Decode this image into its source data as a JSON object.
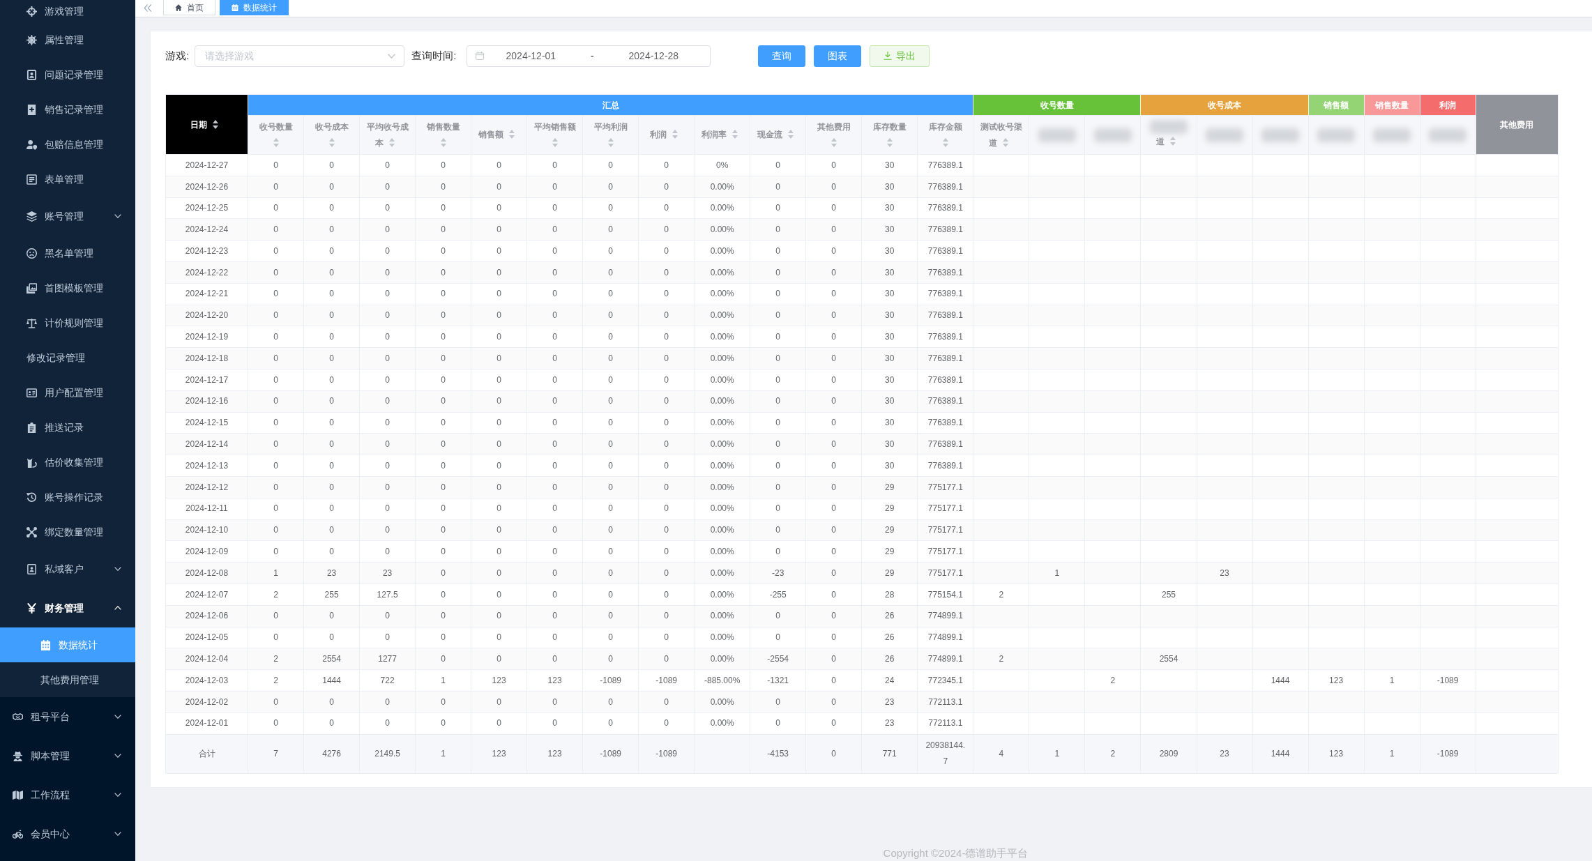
{
  "sidebar": {
    "submenu_items": [
      {
        "label": "游戏管理",
        "kind": "link",
        "selected": false
      },
      {
        "label": "属性管理",
        "kind": "link",
        "selected": false
      },
      {
        "label": "问题记录管理",
        "kind": "link",
        "selected": false
      },
      {
        "label": "销售记录管理",
        "kind": "link",
        "selected": false
      },
      {
        "label": "包赔信息管理",
        "kind": "link",
        "selected": false
      },
      {
        "label": "表单管理",
        "kind": "link",
        "selected": false
      },
      {
        "label": "账号管理",
        "kind": "submenu",
        "selected": false,
        "expanded": false
      },
      {
        "label": "黑名单管理",
        "kind": "link",
        "selected": false
      },
      {
        "label": "首图模板管理",
        "kind": "link",
        "selected": false
      },
      {
        "label": "计价规则管理",
        "kind": "link",
        "selected": false
      },
      {
        "label": "修改记录管理",
        "kind": "link",
        "selected": false
      },
      {
        "label": "用户配置管理",
        "kind": "link",
        "selected": false
      },
      {
        "label": "推送记录",
        "kind": "link",
        "selected": false
      },
      {
        "label": "估价收集管理",
        "kind": "link",
        "selected": false
      },
      {
        "label": "账号操作记录",
        "kind": "link",
        "selected": false
      },
      {
        "label": "绑定数量管理",
        "kind": "link",
        "selected": false
      },
      {
        "label": "私域客户",
        "kind": "submenu",
        "selected": false,
        "expanded": false
      },
      {
        "label": "财务管理",
        "kind": "submenu",
        "selected": false,
        "expanded": true,
        "children": [
          {
            "label": "数据统计",
            "selected": true
          },
          {
            "label": "其他费用管理",
            "selected": false
          }
        ]
      }
    ],
    "items": [
      {
        "label": "租号平台",
        "kind": "submenu",
        "selected": false,
        "expanded": false
      },
      {
        "label": "脚本管理",
        "kind": "submenu",
        "selected": false,
        "expanded": false
      },
      {
        "label": "工作流程",
        "kind": "submenu",
        "selected": false,
        "expanded": false
      },
      {
        "label": "会员中心",
        "kind": "submenu",
        "selected": false,
        "expanded": false
      }
    ]
  },
  "tabs": [
    {
      "label": "首页",
      "selected": false
    },
    {
      "label": "数据统计",
      "selected": true
    }
  ],
  "filters": {
    "game": {
      "label": "游戏:",
      "placeholder": "请选择游戏"
    },
    "date_range": {
      "label": "查询时间:",
      "start": "2024-12-01",
      "separator": "-",
      "end": "2024-12-28"
    },
    "buttons": [
      {
        "label": "查询",
        "kind": "primary"
      },
      {
        "label": "图表",
        "kind": "primary"
      },
      {
        "label": "导出",
        "kind": "export"
      }
    ]
  },
  "table": {
    "header": [
      {
        "kind": "single",
        "label": "日期",
        "color": "#000000",
        "sortable": true
      },
      {
        "kind": "group",
        "label": "汇总",
        "color": "#409eff",
        "columns": [
          {
            "label": "收号数量",
            "blurred": false
          },
          {
            "label": "收号成本",
            "blurred": false
          },
          {
            "label": "平均收号成本",
            "blurred": false
          },
          {
            "label": "销售数量",
            "blurred": false
          },
          {
            "label": "销售额",
            "blurred": false
          },
          {
            "label": "平均销售额",
            "blurred": false
          },
          {
            "label": "平均利润",
            "blurred": false
          },
          {
            "label": "利润",
            "blurred": false
          },
          {
            "label": "利润率",
            "blurred": false
          },
          {
            "label": "现金流",
            "blurred": false
          },
          {
            "label": "其他费用",
            "blurred": false
          },
          {
            "label": "库存数量",
            "blurred": false
          },
          {
            "label": "库存金额",
            "blurred": false
          }
        ]
      },
      {
        "kind": "group",
        "label": "收号数量",
        "color": "#67c23a",
        "columns": [
          {
            "label": "测试收号渠道",
            "blurred": false
          },
          {
            "blurred": true
          },
          {
            "blurred": true
          }
        ]
      },
      {
        "kind": "group",
        "label": "收号成本",
        "color": "#e6a23c",
        "columns": [
          {
            "label": "道",
            "blurred": true
          },
          {
            "blurred": true
          },
          {
            "blurred": true
          }
        ]
      },
      {
        "kind": "group",
        "label": "销售额",
        "color": "#95d475",
        "columns": [
          {
            "blurred": true
          }
        ]
      },
      {
        "kind": "group",
        "label": "销售数量",
        "color": "#f89898",
        "columns": [
          {
            "blurred": true
          }
        ]
      },
      {
        "kind": "group",
        "label": "利润",
        "color": "#f56c6c",
        "columns": [
          {
            "blurred": true
          }
        ]
      },
      {
        "kind": "single",
        "label": "其他费用",
        "color": "#909399",
        "sortable": false
      }
    ],
    "rows": [
      {
        "date": "2024-12-27",
        "cells": [
          "0",
          "0",
          "0",
          "0",
          "0",
          "0",
          "0",
          "0",
          "0%",
          "0",
          "0",
          "30",
          "776389.1",
          null,
          null,
          null,
          null,
          null,
          null,
          null,
          null,
          null,
          null
        ]
      },
      {
        "date": "2024-12-26",
        "cells": [
          "0",
          "0",
          "0",
          "0",
          "0",
          "0",
          "0",
          "0",
          "0.00%",
          "0",
          "0",
          "30",
          "776389.1",
          null,
          null,
          null,
          null,
          null,
          null,
          null,
          null,
          null,
          null
        ]
      },
      {
        "date": "2024-12-25",
        "cells": [
          "0",
          "0",
          "0",
          "0",
          "0",
          "0",
          "0",
          "0",
          "0.00%",
          "0",
          "0",
          "30",
          "776389.1",
          null,
          null,
          null,
          null,
          null,
          null,
          null,
          null,
          null,
          null
        ]
      },
      {
        "date": "2024-12-24",
        "cells": [
          "0",
          "0",
          "0",
          "0",
          "0",
          "0",
          "0",
          "0",
          "0.00%",
          "0",
          "0",
          "30",
          "776389.1",
          null,
          null,
          null,
          null,
          null,
          null,
          null,
          null,
          null,
          null
        ]
      },
      {
        "date": "2024-12-23",
        "cells": [
          "0",
          "0",
          "0",
          "0",
          "0",
          "0",
          "0",
          "0",
          "0.00%",
          "0",
          "0",
          "30",
          "776389.1",
          null,
          null,
          null,
          null,
          null,
          null,
          null,
          null,
          null,
          null
        ]
      },
      {
        "date": "2024-12-22",
        "cells": [
          "0",
          "0",
          "0",
          "0",
          "0",
          "0",
          "0",
          "0",
          "0.00%",
          "0",
          "0",
          "30",
          "776389.1",
          null,
          null,
          null,
          null,
          null,
          null,
          null,
          null,
          null,
          null
        ]
      },
      {
        "date": "2024-12-21",
        "cells": [
          "0",
          "0",
          "0",
          "0",
          "0",
          "0",
          "0",
          "0",
          "0.00%",
          "0",
          "0",
          "30",
          "776389.1",
          null,
          null,
          null,
          null,
          null,
          null,
          null,
          null,
          null,
          null
        ]
      },
      {
        "date": "2024-12-20",
        "cells": [
          "0",
          "0",
          "0",
          "0",
          "0",
          "0",
          "0",
          "0",
          "0.00%",
          "0",
          "0",
          "30",
          "776389.1",
          null,
          null,
          null,
          null,
          null,
          null,
          null,
          null,
          null,
          null
        ]
      },
      {
        "date": "2024-12-19",
        "cells": [
          "0",
          "0",
          "0",
          "0",
          "0",
          "0",
          "0",
          "0",
          "0.00%",
          "0",
          "0",
          "30",
          "776389.1",
          null,
          null,
          null,
          null,
          null,
          null,
          null,
          null,
          null,
          null
        ]
      },
      {
        "date": "2024-12-18",
        "cells": [
          "0",
          "0",
          "0",
          "0",
          "0",
          "0",
          "0",
          "0",
          "0.00%",
          "0",
          "0",
          "30",
          "776389.1",
          null,
          null,
          null,
          null,
          null,
          null,
          null,
          null,
          null,
          null
        ]
      },
      {
        "date": "2024-12-17",
        "cells": [
          "0",
          "0",
          "0",
          "0",
          "0",
          "0",
          "0",
          "0",
          "0.00%",
          "0",
          "0",
          "30",
          "776389.1",
          null,
          null,
          null,
          null,
          null,
          null,
          null,
          null,
          null,
          null
        ]
      },
      {
        "date": "2024-12-16",
        "cells": [
          "0",
          "0",
          "0",
          "0",
          "0",
          "0",
          "0",
          "0",
          "0.00%",
          "0",
          "0",
          "30",
          "776389.1",
          null,
          null,
          null,
          null,
          null,
          null,
          null,
          null,
          null,
          null
        ]
      },
      {
        "date": "2024-12-15",
        "cells": [
          "0",
          "0",
          "0",
          "0",
          "0",
          "0",
          "0",
          "0",
          "0.00%",
          "0",
          "0",
          "30",
          "776389.1",
          null,
          null,
          null,
          null,
          null,
          null,
          null,
          null,
          null,
          null
        ]
      },
      {
        "date": "2024-12-14",
        "cells": [
          "0",
          "0",
          "0",
          "0",
          "0",
          "0",
          "0",
          "0",
          "0.00%",
          "0",
          "0",
          "30",
          "776389.1",
          null,
          null,
          null,
          null,
          null,
          null,
          null,
          null,
          null,
          null
        ]
      },
      {
        "date": "2024-12-13",
        "cells": [
          "0",
          "0",
          "0",
          "0",
          "0",
          "0",
          "0",
          "0",
          "0.00%",
          "0",
          "0",
          "30",
          "776389.1",
          null,
          null,
          null,
          null,
          null,
          null,
          null,
          null,
          null,
          null
        ]
      },
      {
        "date": "2024-12-12",
        "cells": [
          "0",
          "0",
          "0",
          "0",
          "0",
          "0",
          "0",
          "0",
          "0.00%",
          "0",
          "0",
          "29",
          "775177.1",
          null,
          null,
          null,
          null,
          null,
          null,
          null,
          null,
          null,
          null
        ]
      },
      {
        "date": "2024-12-11",
        "cells": [
          "0",
          "0",
          "0",
          "0",
          "0",
          "0",
          "0",
          "0",
          "0.00%",
          "0",
          "0",
          "29",
          "775177.1",
          null,
          null,
          null,
          null,
          null,
          null,
          null,
          null,
          null,
          null
        ]
      },
      {
        "date": "2024-12-10",
        "cells": [
          "0",
          "0",
          "0",
          "0",
          "0",
          "0",
          "0",
          "0",
          "0.00%",
          "0",
          "0",
          "29",
          "775177.1",
          null,
          null,
          null,
          null,
          null,
          null,
          null,
          null,
          null,
          null
        ]
      },
      {
        "date": "2024-12-09",
        "cells": [
          "0",
          "0",
          "0",
          "0",
          "0",
          "0",
          "0",
          "0",
          "0.00%",
          "0",
          "0",
          "29",
          "775177.1",
          null,
          null,
          null,
          null,
          null,
          null,
          null,
          null,
          null,
          null
        ]
      },
      {
        "date": "2024-12-08",
        "cells": [
          "1",
          "23",
          "23",
          "0",
          "0",
          "0",
          "0",
          "0",
          "0.00%",
          "-23",
          "0",
          "29",
          "775177.1",
          null,
          "1",
          null,
          null,
          "23",
          null,
          null,
          null,
          null,
          null
        ]
      },
      {
        "date": "2024-12-07",
        "cells": [
          "2",
          "255",
          "127.5",
          "0",
          "0",
          "0",
          "0",
          "0",
          "0.00%",
          "-255",
          "0",
          "28",
          "775154.1",
          "2",
          null,
          null,
          "255",
          null,
          null,
          null,
          null,
          null,
          null
        ]
      },
      {
        "date": "2024-12-06",
        "cells": [
          "0",
          "0",
          "0",
          "0",
          "0",
          "0",
          "0",
          "0",
          "0.00%",
          "0",
          "0",
          "26",
          "774899.1",
          null,
          null,
          null,
          null,
          null,
          null,
          null,
          null,
          null,
          null
        ]
      },
      {
        "date": "2024-12-05",
        "cells": [
          "0",
          "0",
          "0",
          "0",
          "0",
          "0",
          "0",
          "0",
          "0.00%",
          "0",
          "0",
          "26",
          "774899.1",
          null,
          null,
          null,
          null,
          null,
          null,
          null,
          null,
          null,
          null
        ]
      },
      {
        "date": "2024-12-04",
        "cells": [
          "2",
          "2554",
          "1277",
          "0",
          "0",
          "0",
          "0",
          "0",
          "0.00%",
          "-2554",
          "0",
          "26",
          "774899.1",
          "2",
          null,
          null,
          "2554",
          null,
          null,
          null,
          null,
          null,
          null
        ]
      },
      {
        "date": "2024-12-03",
        "cells": [
          "2",
          "1444",
          "722",
          "1",
          "123",
          "123",
          "-1089",
          "-1089",
          "-885.00%",
          "-1321",
          "0",
          "24",
          "772345.1",
          null,
          null,
          "2",
          null,
          null,
          "1444",
          "123",
          "1",
          "-1089",
          null
        ]
      },
      {
        "date": "2024-12-02",
        "cells": [
          "0",
          "0",
          "0",
          "0",
          "0",
          "0",
          "0",
          "0",
          "0.00%",
          "0",
          "0",
          "23",
          "772113.1",
          null,
          null,
          null,
          null,
          null,
          null,
          null,
          null,
          null,
          null
        ]
      },
      {
        "date": "2024-12-01",
        "cells": [
          "0",
          "0",
          "0",
          "0",
          "0",
          "0",
          "0",
          "0",
          "0.00%",
          "0",
          "0",
          "23",
          "772113.1",
          null,
          null,
          null,
          null,
          null,
          null,
          null,
          null,
          null,
          null
        ]
      }
    ],
    "total": {
      "label": "合计",
      "cells": [
        "7",
        "4276",
        "2149.5",
        "1",
        "123",
        "123",
        "-1089",
        "-1089",
        null,
        "-4153",
        "0",
        "771",
        "20938144.7",
        "4",
        "1",
        "2",
        "2809",
        "23",
        "1444",
        "123",
        "1",
        "-1089",
        null
      ]
    }
  },
  "footer": {
    "text": "Copyright ©2024-德谱助手平台"
  }
}
